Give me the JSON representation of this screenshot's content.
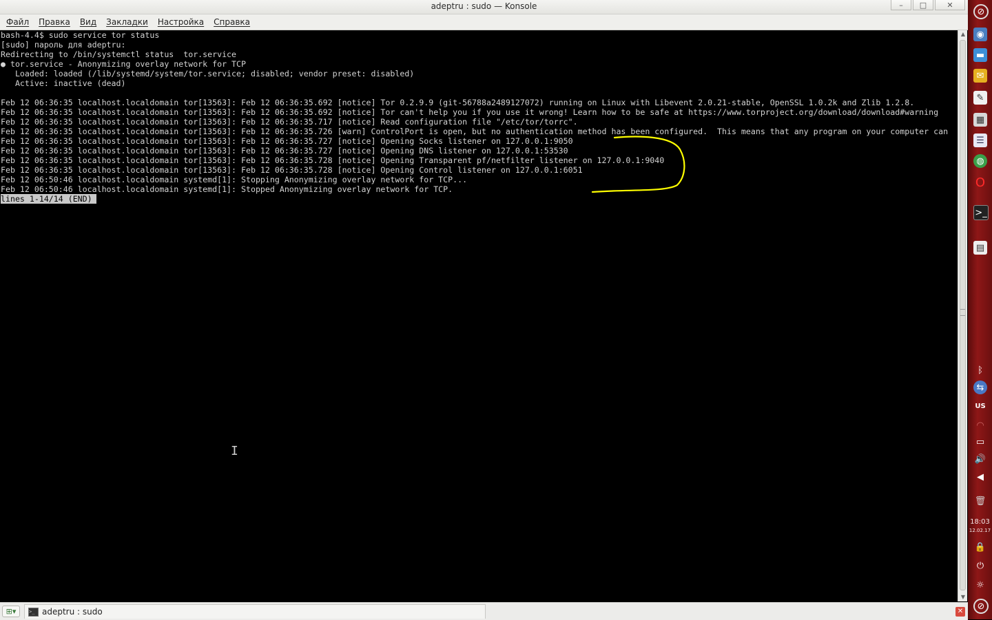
{
  "window": {
    "title": "adeptru : sudo — Konsole",
    "controls": {
      "minimize": "–",
      "maximize": "□",
      "close": "✕"
    }
  },
  "menubar": [
    "Файл",
    "Правка",
    "Вид",
    "Закладки",
    "Настройка",
    "Справка"
  ],
  "terminal": {
    "lines": [
      "bash-4.4$ sudo service tor status",
      "[sudo] пароль для adeptru:",
      "Redirecting to /bin/systemctl status  tor.service",
      "● tor.service - Anonymizing overlay network for TCP",
      "   Loaded: loaded (/lib/systemd/system/tor.service; disabled; vendor preset: disabled)",
      "   Active: inactive (dead)",
      "",
      "Feb 12 06:36:35 localhost.localdomain tor[13563]: Feb 12 06:36:35.692 [notice] Tor 0.2.9.9 (git-56788a2489127072) running on Linux with Libevent 2.0.21-stable, OpenSSL 1.0.2k and Zlib 1.2.8.",
      "Feb 12 06:36:35 localhost.localdomain tor[13563]: Feb 12 06:36:35.692 [notice] Tor can't help you if you use it wrong! Learn how to be safe at https://www.torproject.org/download/download#warning",
      "Feb 12 06:36:35 localhost.localdomain tor[13563]: Feb 12 06:36:35.717 [notice] Read configuration file \"/etc/tor/torrc\".",
      "Feb 12 06:36:35 localhost.localdomain tor[13563]: Feb 12 06:36:35.726 [warn] ControlPort is open, but no authentication method has been configured.  This means that any program on your computer can",
      "Feb 12 06:36:35 localhost.localdomain tor[13563]: Feb 12 06:36:35.727 [notice] Opening Socks listener on 127.0.0.1:9050",
      "Feb 12 06:36:35 localhost.localdomain tor[13563]: Feb 12 06:36:35.727 [notice] Opening DNS listener on 127.0.0.1:53530",
      "Feb 12 06:36:35 localhost.localdomain tor[13563]: Feb 12 06:36:35.728 [notice] Opening Transparent pf/netfilter listener on 127.0.0.1:9040",
      "Feb 12 06:36:35 localhost.localdomain tor[13563]: Feb 12 06:36:35.728 [notice] Opening Control listener on 127.0.0.1:6051",
      "Feb 12 06:50:46 localhost.localdomain systemd[1]: Stopping Anonymizing overlay network for TCP...",
      "Feb 12 06:50:46 localhost.localdomain systemd[1]: Stopped Anonymizing overlay network for TCP."
    ],
    "pager_status": "lines 1-14/14 (END)",
    "annotation_color": "#ffff00"
  },
  "tabbar": {
    "tab_label": "adeptru : sudo"
  },
  "dock": {
    "time": "18:03",
    "date": "12.02.17",
    "keyboard_layout": "US",
    "items": [
      "opera-launcher-icon",
      "finder-icon",
      "folder-icon",
      "mail-icon",
      "text-editor-icon",
      "calculator-icon",
      "document-viewer-icon",
      "network-globe-icon",
      "opera-icon",
      "konsole-icon",
      "notes-icon",
      "bluetooth-icon",
      "network-manager-icon",
      "keyboard-layout-icon",
      "wifi-icon",
      "battery-icon",
      "volume-icon",
      "media-back-icon",
      "trash-icon",
      "lock-icon",
      "power-icon",
      "brightness-icon",
      "opera-bottom-icon"
    ]
  }
}
